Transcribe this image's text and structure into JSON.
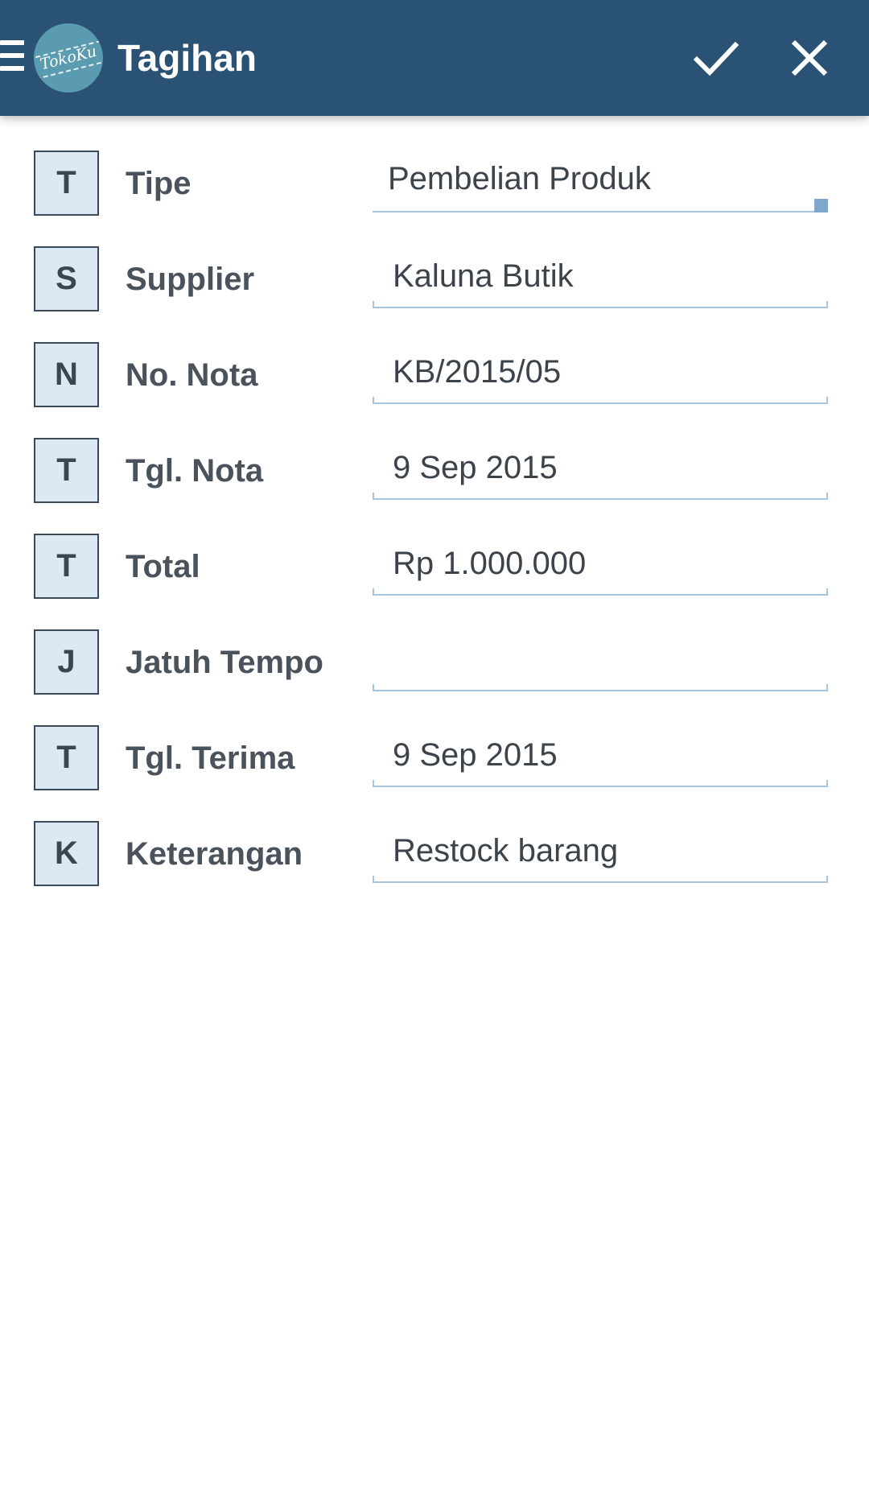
{
  "toolbar": {
    "title": "Tagihan",
    "logo_text": "TokoKu",
    "menu_icon": "hamburger-menu-icon",
    "save_icon": "check-icon",
    "close_icon": "close-icon",
    "background_color": "#2a5275"
  },
  "form": {
    "fields": [
      {
        "badge": "T",
        "label": "Tipe",
        "value": "Pembelian Produk"
      },
      {
        "badge": "S",
        "label": "Supplier",
        "value": "Kaluna Butik"
      },
      {
        "badge": "N",
        "label": "No. Nota",
        "value": "KB/2015/05"
      },
      {
        "badge": "T",
        "label": "Tgl. Nota",
        "value": "9 Sep 2015"
      },
      {
        "badge": "T",
        "label": "Total",
        "value": "Rp 1.000.000"
      },
      {
        "badge": "J",
        "label": "Jatuh Tempo",
        "value": ""
      },
      {
        "badge": "T",
        "label": "Tgl. Terima",
        "value": "9 Sep 2015"
      },
      {
        "badge": "K",
        "label": "Keterangan",
        "value": "Restock barang"
      }
    ]
  },
  "colors": {
    "badge_bg": "#dce9f4",
    "underline": "#a7c6de",
    "accent": "#7fa8cc"
  }
}
